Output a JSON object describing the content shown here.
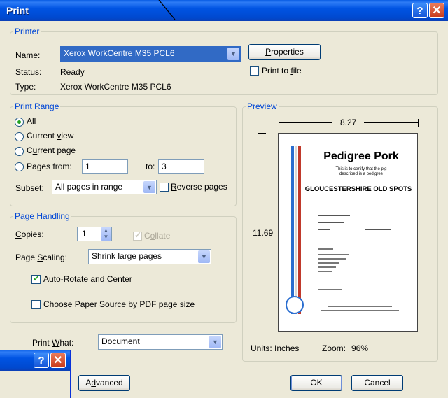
{
  "window": {
    "title": "Print",
    "help_glyph": "?",
    "close_glyph": "✕"
  },
  "printer": {
    "legend": "Printer",
    "name_label": "Name:",
    "name_value": "Xerox WorkCentre M35 PCL6",
    "status_label": "Status:",
    "status_value": "Ready",
    "type_label": "Type:",
    "type_value": "Xerox WorkCentre M35 PCL6",
    "properties_label": "Properties",
    "print_to_file_label": "Print to file",
    "print_to_file_checked": false
  },
  "print_range": {
    "legend": "Print Range",
    "all_label": "All",
    "current_view_label": "Current view",
    "current_page_label": "Current page",
    "pages_label": "Pages",
    "from_label": "from:",
    "from_value": "1",
    "to_label": "to:",
    "to_value": "3",
    "selected": "all",
    "subset_label": "Subset:",
    "subset_value": "All pages in range",
    "reverse_pages_label": "Reverse pages",
    "reverse_pages_checked": false
  },
  "page_handling": {
    "legend": "Page Handling",
    "copies_label": "Copies:",
    "copies_value": "1",
    "collate_label": "Collate",
    "collate_checked": true,
    "collate_enabled": false,
    "scaling_label": "Page Scaling:",
    "scaling_value": "Shrink large pages",
    "auto_rotate_label": "Auto-Rotate and Center",
    "auto_rotate_checked": true,
    "paper_source_label": "Choose Paper Source by PDF page size",
    "paper_source_checked": false
  },
  "print_what": {
    "label": "Print What:",
    "value": "Document"
  },
  "preview": {
    "legend": "Preview",
    "width_value": "8.27",
    "height_value": "11.69",
    "units_label": "Units: Inches",
    "zoom_label": "Zoom:",
    "zoom_value": "96%",
    "doc_title": "Pedigree Pork",
    "doc_subtitle_line1": "This is to certify that the pig",
    "doc_subtitle_line2": "described is a pedigree",
    "doc_breed": "GLOUCESTERSHIRE OLD SPOTS"
  },
  "buttons": {
    "advanced_label": "Advanced",
    "ok_label": "OK",
    "cancel_label": "Cancel"
  },
  "back_window": {
    "help_glyph": "?",
    "close_glyph": "✕"
  },
  "colors": {
    "titlebar": "#0054e3",
    "dialog_bg": "#ece9d8",
    "legend_text": "#0046d5",
    "selected_combo": "#316ac5"
  }
}
